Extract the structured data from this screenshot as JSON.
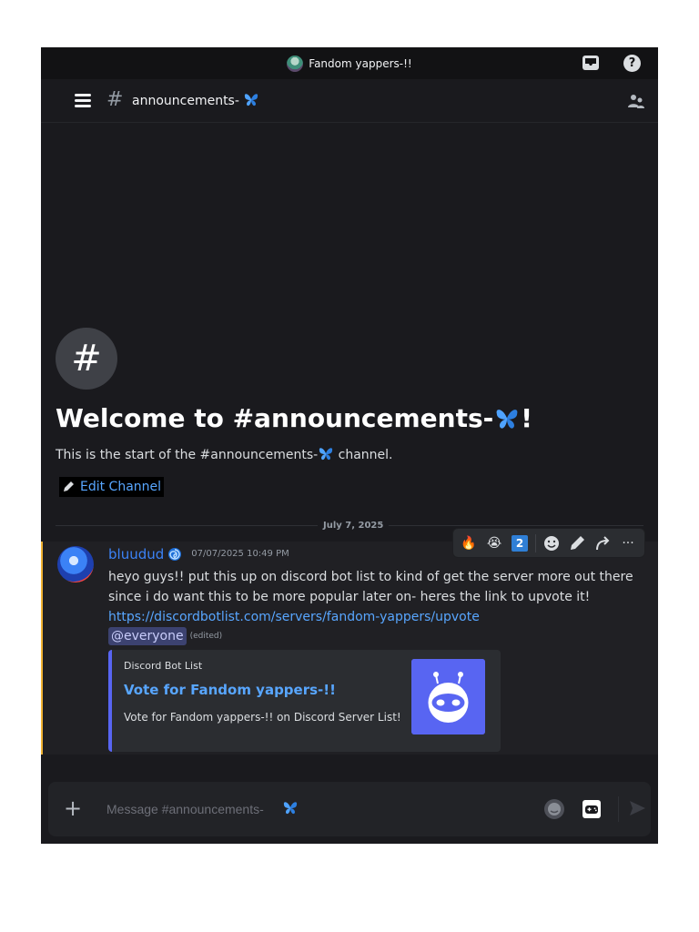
{
  "titlebar": {
    "server_name": "Fandom yappers-!!",
    "icons": [
      "server-icon",
      "inbox-icon",
      "help-icon"
    ]
  },
  "channel_header": {
    "hash": "#",
    "name": "announcements-",
    "name_emoji": "butterfly-icon",
    "icons": [
      "hamburger-menu-icon",
      "members-icon"
    ]
  },
  "welcome": {
    "icon": "#",
    "title_prefix": "Welcome to #announcements-",
    "title_suffix": "!",
    "subtitle_prefix": "This is the start of the #announcements-",
    "subtitle_suffix": " channel.",
    "edit_label": "Edit Channel"
  },
  "divider": {
    "date": "July 7, 2025"
  },
  "message": {
    "username": "bluudud",
    "timestamp": "07/07/2025 10:49 PM",
    "text": "heyo guys!! put this up on discord bot list to kind of get the server more out there since i do want this to be more popular later on- heres the link to upvote it!",
    "link": "https://discordbotlist.com/servers/fandom-yappers/upvote",
    "mention": "@everyone",
    "edited": "(edited)",
    "embed": {
      "provider": "Discord Bot List",
      "title": "Vote for Fandom yappers-!!",
      "description": "Vote for Fandom yappers-!! on Discord Server List!"
    },
    "accent_color": "#f0b232"
  },
  "toolbar": {
    "reaction_1": "🔥",
    "reaction_2": "😭",
    "reaction_3": "2",
    "icons": [
      "add-reaction-icon",
      "edit-icon",
      "forward-icon",
      "more-icon"
    ],
    "more_label": "···"
  },
  "composer": {
    "plus": "+",
    "placeholder": "Message #announcements-",
    "icons": [
      "emoji-icon",
      "gift-game-icon",
      "send-icon"
    ]
  },
  "colors": {
    "background": "#1a1a1e",
    "link": "#58a6ff",
    "username": "#3b82f6",
    "blurple": "#5865f2"
  }
}
